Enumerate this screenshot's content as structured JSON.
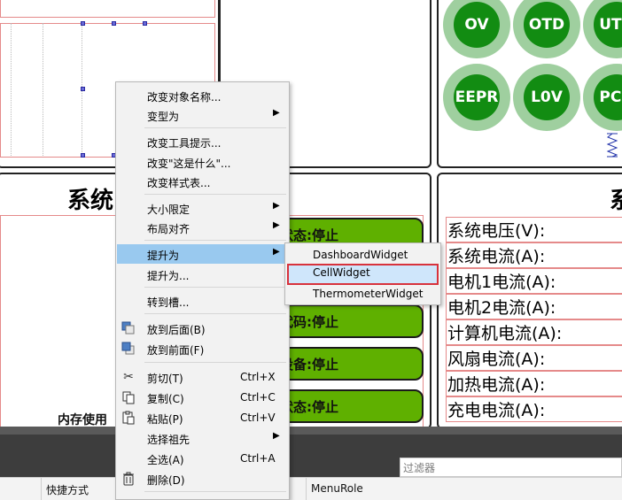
{
  "canvas": {
    "indicators": [
      "OV",
      "OTD",
      "UTD",
      "EEPR",
      "L0V",
      "PCH"
    ],
    "left_title": "系统",
    "right_title": "系",
    "status_buttons": [
      "状态:停止",
      "代码:停止",
      "设备:停止",
      "状态:停止"
    ],
    "memory_label": "内存使用",
    "value_rows": [
      "系统电压(V):",
      "系统电流(A):",
      "电机1电流(A):",
      "电机2电流(A):",
      "计算机电流(A):",
      "风扇电流(A):",
      "加热电流(A):",
      "充电电流(A):"
    ]
  },
  "context_menu": {
    "items": [
      {
        "label": "改变对象名称...",
        "shortcut": "",
        "submenu": false,
        "icon": ""
      },
      {
        "label": "变型为",
        "shortcut": "",
        "submenu": true,
        "icon": ""
      },
      {
        "label": "改变工具提示...",
        "shortcut": "",
        "submenu": false,
        "icon": ""
      },
      {
        "label": "改变\"这是什么\"...",
        "shortcut": "",
        "submenu": false,
        "icon": ""
      },
      {
        "label": "改变样式表...",
        "shortcut": "",
        "submenu": false,
        "icon": ""
      },
      {
        "label": "大小限定",
        "shortcut": "",
        "submenu": true,
        "icon": ""
      },
      {
        "label": "布局对齐",
        "shortcut": "",
        "submenu": true,
        "icon": ""
      },
      {
        "label": "提升为",
        "shortcut": "",
        "submenu": true,
        "icon": "",
        "selected": true
      },
      {
        "label": "提升为...",
        "shortcut": "",
        "submenu": false,
        "icon": ""
      },
      {
        "label": "转到槽...",
        "shortcut": "",
        "submenu": false,
        "icon": ""
      },
      {
        "label": "放到后面(B)",
        "shortcut": "",
        "submenu": false,
        "icon": "send-to-back-icon"
      },
      {
        "label": "放到前面(F)",
        "shortcut": "",
        "submenu": false,
        "icon": "bring-to-front-icon"
      },
      {
        "label": "剪切(T)",
        "shortcut": "Ctrl+X",
        "submenu": false,
        "icon": "scissors-icon"
      },
      {
        "label": "复制(C)",
        "shortcut": "Ctrl+C",
        "submenu": false,
        "icon": "copy-icon"
      },
      {
        "label": "粘贴(P)",
        "shortcut": "Ctrl+V",
        "submenu": false,
        "icon": "paste-icon"
      },
      {
        "label": "选择祖先",
        "shortcut": "",
        "submenu": true,
        "icon": ""
      },
      {
        "label": "全选(A)",
        "shortcut": "Ctrl+A",
        "submenu": false,
        "icon": ""
      },
      {
        "label": "删除(D)",
        "shortcut": "",
        "submenu": false,
        "icon": "trash-icon"
      }
    ],
    "arrow": "▶"
  },
  "promote_submenu": {
    "items": [
      "DashboardWidget",
      "CellWidget",
      "ThermometerWidget"
    ],
    "selected": "CellWidget"
  },
  "bottom": {
    "filter_placeholder": "过滤器",
    "shortcut_col": "快捷方式",
    "menurole_col": "MenuRole"
  },
  "colors": {
    "indicator_fill": "#128c12",
    "indicator_ring": "#9fcf9f",
    "status_button": "#5fb000",
    "menu_highlight": "#99c9ef",
    "submenu_border": "#d8323c"
  }
}
